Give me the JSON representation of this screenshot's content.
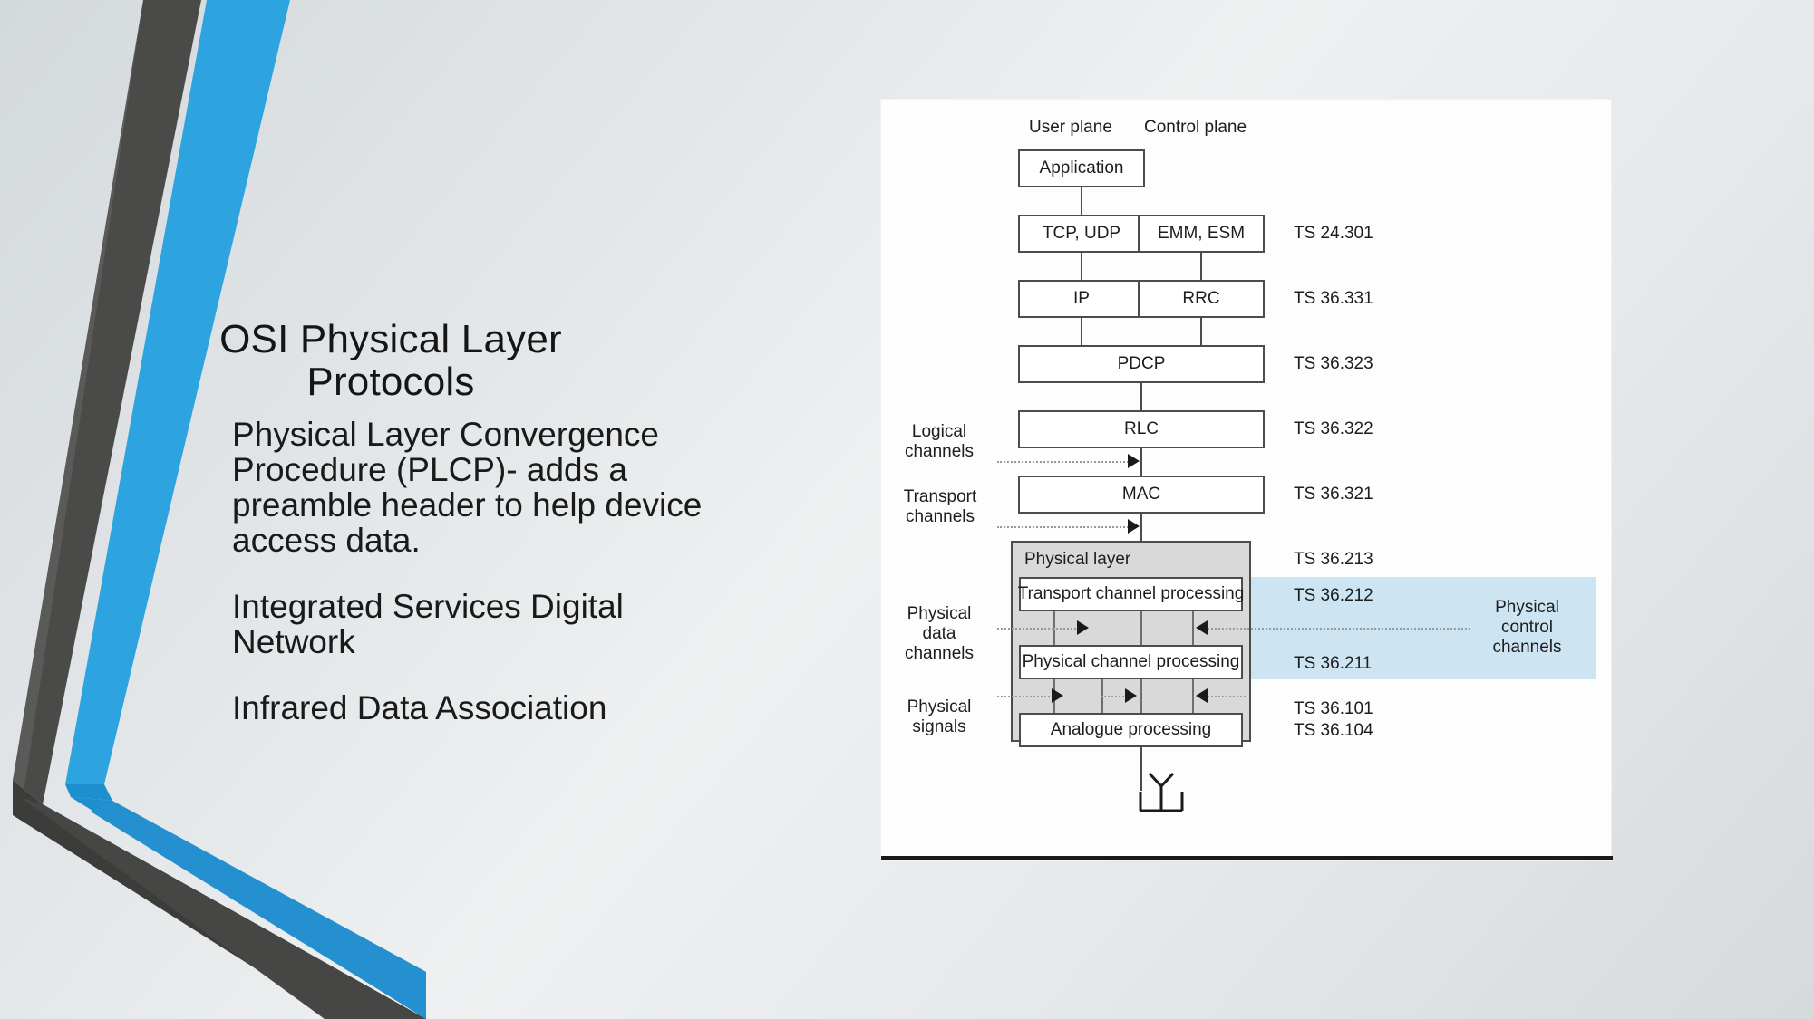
{
  "slide": {
    "title": "OSI Physical Layer Protocols",
    "paragraphs": [
      "Physical Layer Convergence Procedure (PLCP)- adds a preamble header to help device access data.",
      "Integrated Services Digital Network",
      "Infrared Data Association"
    ],
    "theme": {
      "accent_blue": "#2da3e0",
      "accent_blue_dark": "#1d8fce",
      "accent_gray": "#4a4a48",
      "accent_gray_dark": "#3a3a38",
      "background_light": "#eef0f1"
    }
  },
  "figure": {
    "plane_headers": [
      "User plane",
      "Control plane"
    ],
    "user_plane_stack": [
      "Application",
      "TCP, UDP",
      "IP"
    ],
    "control_plane_stack": [
      "EMM, ESM",
      "RRC"
    ],
    "shared_stack": [
      "PDCP",
      "RLC",
      "MAC"
    ],
    "physical_layer_title": "Physical layer",
    "physical_layer_blocks": [
      "Transport channel processing",
      "Physical channel processing",
      "Analogue processing"
    ],
    "left_labels": [
      "Logical channels",
      "Transport channels",
      "Physical data channels",
      "Physical signals"
    ],
    "right_label": "Physical control channels",
    "spec_labels": [
      "TS 24.301",
      "TS 36.331",
      "TS 36.323",
      "TS 36.322",
      "TS 36.321",
      "TS 36.213",
      "TS 36.212",
      "TS 36.211",
      "TS 36.101",
      "TS 36.104"
    ]
  }
}
